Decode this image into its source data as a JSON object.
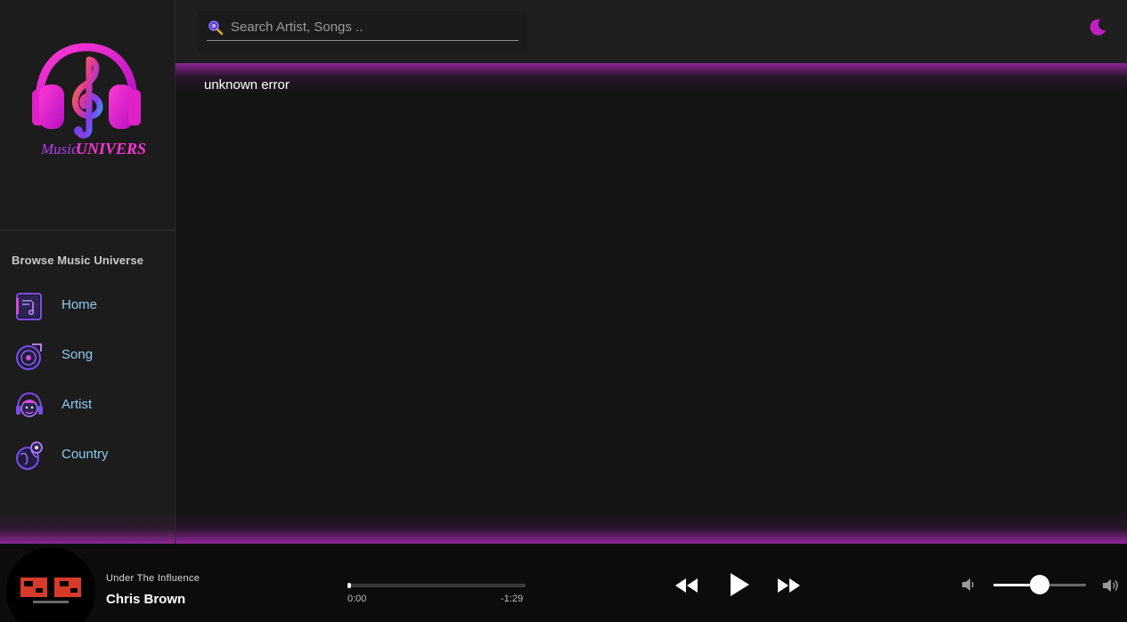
{
  "brand": {
    "logo_text": "Music UNIVERSE",
    "colors": {
      "accent": "#c21fc2",
      "nav_text": "#8ecbf0",
      "glow": "#a828aa"
    }
  },
  "sidebar": {
    "section_title": "Browse Music Universe",
    "items": [
      {
        "label": "Home",
        "icon": "home-music-icon"
      },
      {
        "label": "Song",
        "icon": "vinyl-record-icon"
      },
      {
        "label": "Artist",
        "icon": "artist-face-icon"
      },
      {
        "label": "Country",
        "icon": "globe-pin-icon"
      }
    ]
  },
  "header": {
    "search": {
      "placeholder": "Search Artist, Songs ..",
      "value": ""
    },
    "theme_toggle_icon": "moon-icon"
  },
  "main": {
    "message": "unknown error"
  },
  "player": {
    "song_title": "Under The Influence",
    "artist": "Chris Brown",
    "elapsed": "0:00",
    "remaining": "-1:29",
    "progress_fraction": 0,
    "volume_fraction": 0.5,
    "controls": {
      "rewind_icon": "rewind-icon",
      "play_icon": "play-icon",
      "forward_icon": "fast-forward-icon",
      "volume_low_icon": "volume-low-icon",
      "volume_high_icon": "volume-high-icon"
    }
  }
}
